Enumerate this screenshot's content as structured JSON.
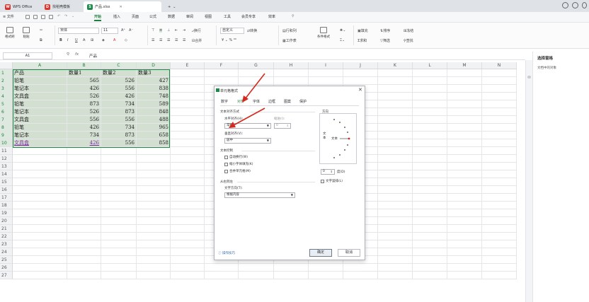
{
  "tabbar": {
    "tabs": [
      {
        "label": "WPS Office"
      },
      {
        "label": "找稻壳模板"
      },
      {
        "label": "产品.xlsx"
      }
    ],
    "new_tab": "+",
    "new_tab_arrow": "⌄"
  },
  "menubar": {
    "file_menu": "≡ 文件",
    "items": [
      "开始",
      "插入",
      "页面",
      "公式",
      "数据",
      "审阅",
      "视图",
      "工具",
      "会员专享",
      "效率"
    ],
    "active": "开始"
  },
  "ribbon": {
    "format_painter": "格式刷",
    "paste": "粘贴",
    "font_name": "宋体",
    "font_size": "11",
    "bold": "B",
    "italic": "I",
    "underline": "U",
    "wrap": "换行",
    "merge": "合并",
    "number_format": "自定义",
    "convert": "转换",
    "rows_cols": "行和列",
    "worksheet": "工作表",
    "cond_format": "条件格式",
    "fill": "填充",
    "sort": "排序",
    "freeze": "冻结",
    "sum": "求和",
    "filter": "筛选",
    "find": "查找"
  },
  "formula_bar": {
    "name_box": "A1",
    "fx": "fx",
    "content": "产品"
  },
  "right_pane": {
    "title": "选择窗格",
    "subtitle": "文档中的对象"
  },
  "grid": {
    "columns": [
      "A",
      "B",
      "C",
      "D",
      "E",
      "F",
      "G",
      "H",
      "I",
      "J",
      "K",
      "L",
      "M",
      "N"
    ],
    "rows": [
      "1",
      "2",
      "3",
      "4",
      "5",
      "6",
      "7",
      "8",
      "9",
      "10",
      "11",
      "12",
      "13",
      "14",
      "15",
      "16",
      "17",
      "18",
      "19",
      "20",
      "21",
      "22",
      "23",
      "24",
      "25",
      "26",
      "27"
    ],
    "headers": [
      "产品",
      "数量1",
      "数量2",
      "数量3"
    ],
    "data": [
      [
        "铅笔",
        "565",
        "526",
        "427"
      ],
      [
        "笔记本",
        "426",
        "556",
        "838"
      ],
      [
        "文具盒",
        "526",
        "426",
        "748"
      ],
      [
        "铅笔",
        "873",
        "734",
        "589"
      ],
      [
        "笔记本",
        "526",
        "873",
        "848"
      ],
      [
        "文具盒",
        "556",
        "556",
        "488"
      ],
      [
        "铅笔",
        "426",
        "734",
        "965"
      ],
      [
        "笔记本",
        "734",
        "873",
        "658"
      ],
      [
        "文具盒",
        "426",
        "556",
        "858"
      ]
    ]
  },
  "dialog": {
    "title": "单元格格式",
    "close": "✕",
    "tabs": [
      "数字",
      "对齐",
      "字体",
      "边框",
      "图案",
      "保护"
    ],
    "active_tab": "对齐",
    "text_align_group": "文本对齐方式",
    "horizontal_label": "水平对齐(H):",
    "horizontal_value": "常规",
    "indent_label": "缩进(I):",
    "indent_value": "0",
    "vertical_label": "垂直对齐(V):",
    "vertical_value": "居中",
    "text_control_group": "文本控制",
    "wrap_text": "自动换行(W)",
    "shrink_fit": "缩小字体填充(K)",
    "merge_cells": "合并单元格(M)",
    "rtl_group": "从右到左",
    "direction_label": "文字方向(T):",
    "direction_value": "根据内容",
    "orientation_group": "方向",
    "orientation_vertical": "文本",
    "orientation_text": "文本",
    "degrees_value": "0",
    "degrees_label": "度(D)",
    "vertical_text": "文字竖排(L)",
    "tips_link": "操作技巧",
    "ok": "确定",
    "cancel": "取消"
  },
  "colors": {
    "accent_green": "#1e7f3f",
    "selection_fill": "#d3dfd1",
    "arrow_red": "#d42a1e"
  }
}
